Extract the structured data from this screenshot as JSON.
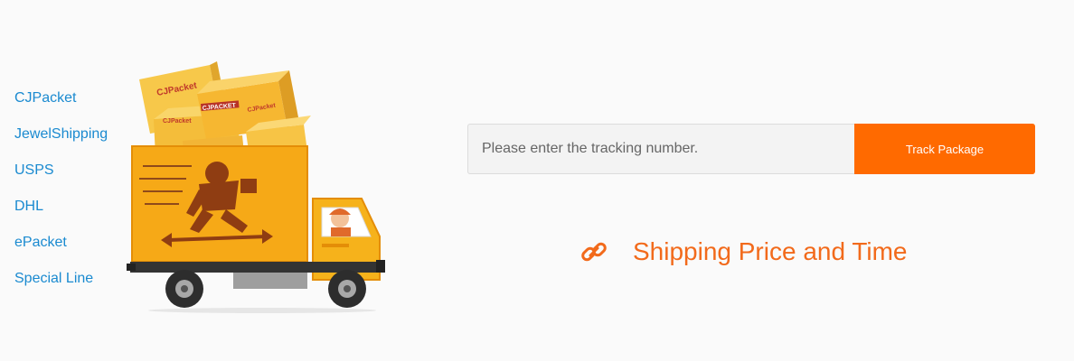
{
  "carriers": [
    {
      "label": "CJPacket"
    },
    {
      "label": "JewelShipping"
    },
    {
      "label": "USPS"
    },
    {
      "label": "DHL"
    },
    {
      "label": "ePacket"
    },
    {
      "label": "Special Line"
    }
  ],
  "illustration": {
    "box_labels": [
      "CJPacket",
      "CJPACKET",
      "CJPacket",
      "CJPacket"
    ]
  },
  "tracking": {
    "placeholder": "Please enter the tracking number.",
    "value": "",
    "button_label": "Track Package"
  },
  "shipping_link": {
    "icon": "link-icon",
    "label": "Shipping Price and Time"
  },
  "colors": {
    "accent": "#ff6a00",
    "link_text": "#f26a1b",
    "carrier_link": "#1a8ad0",
    "truck_yellow": "#f6b21b"
  }
}
